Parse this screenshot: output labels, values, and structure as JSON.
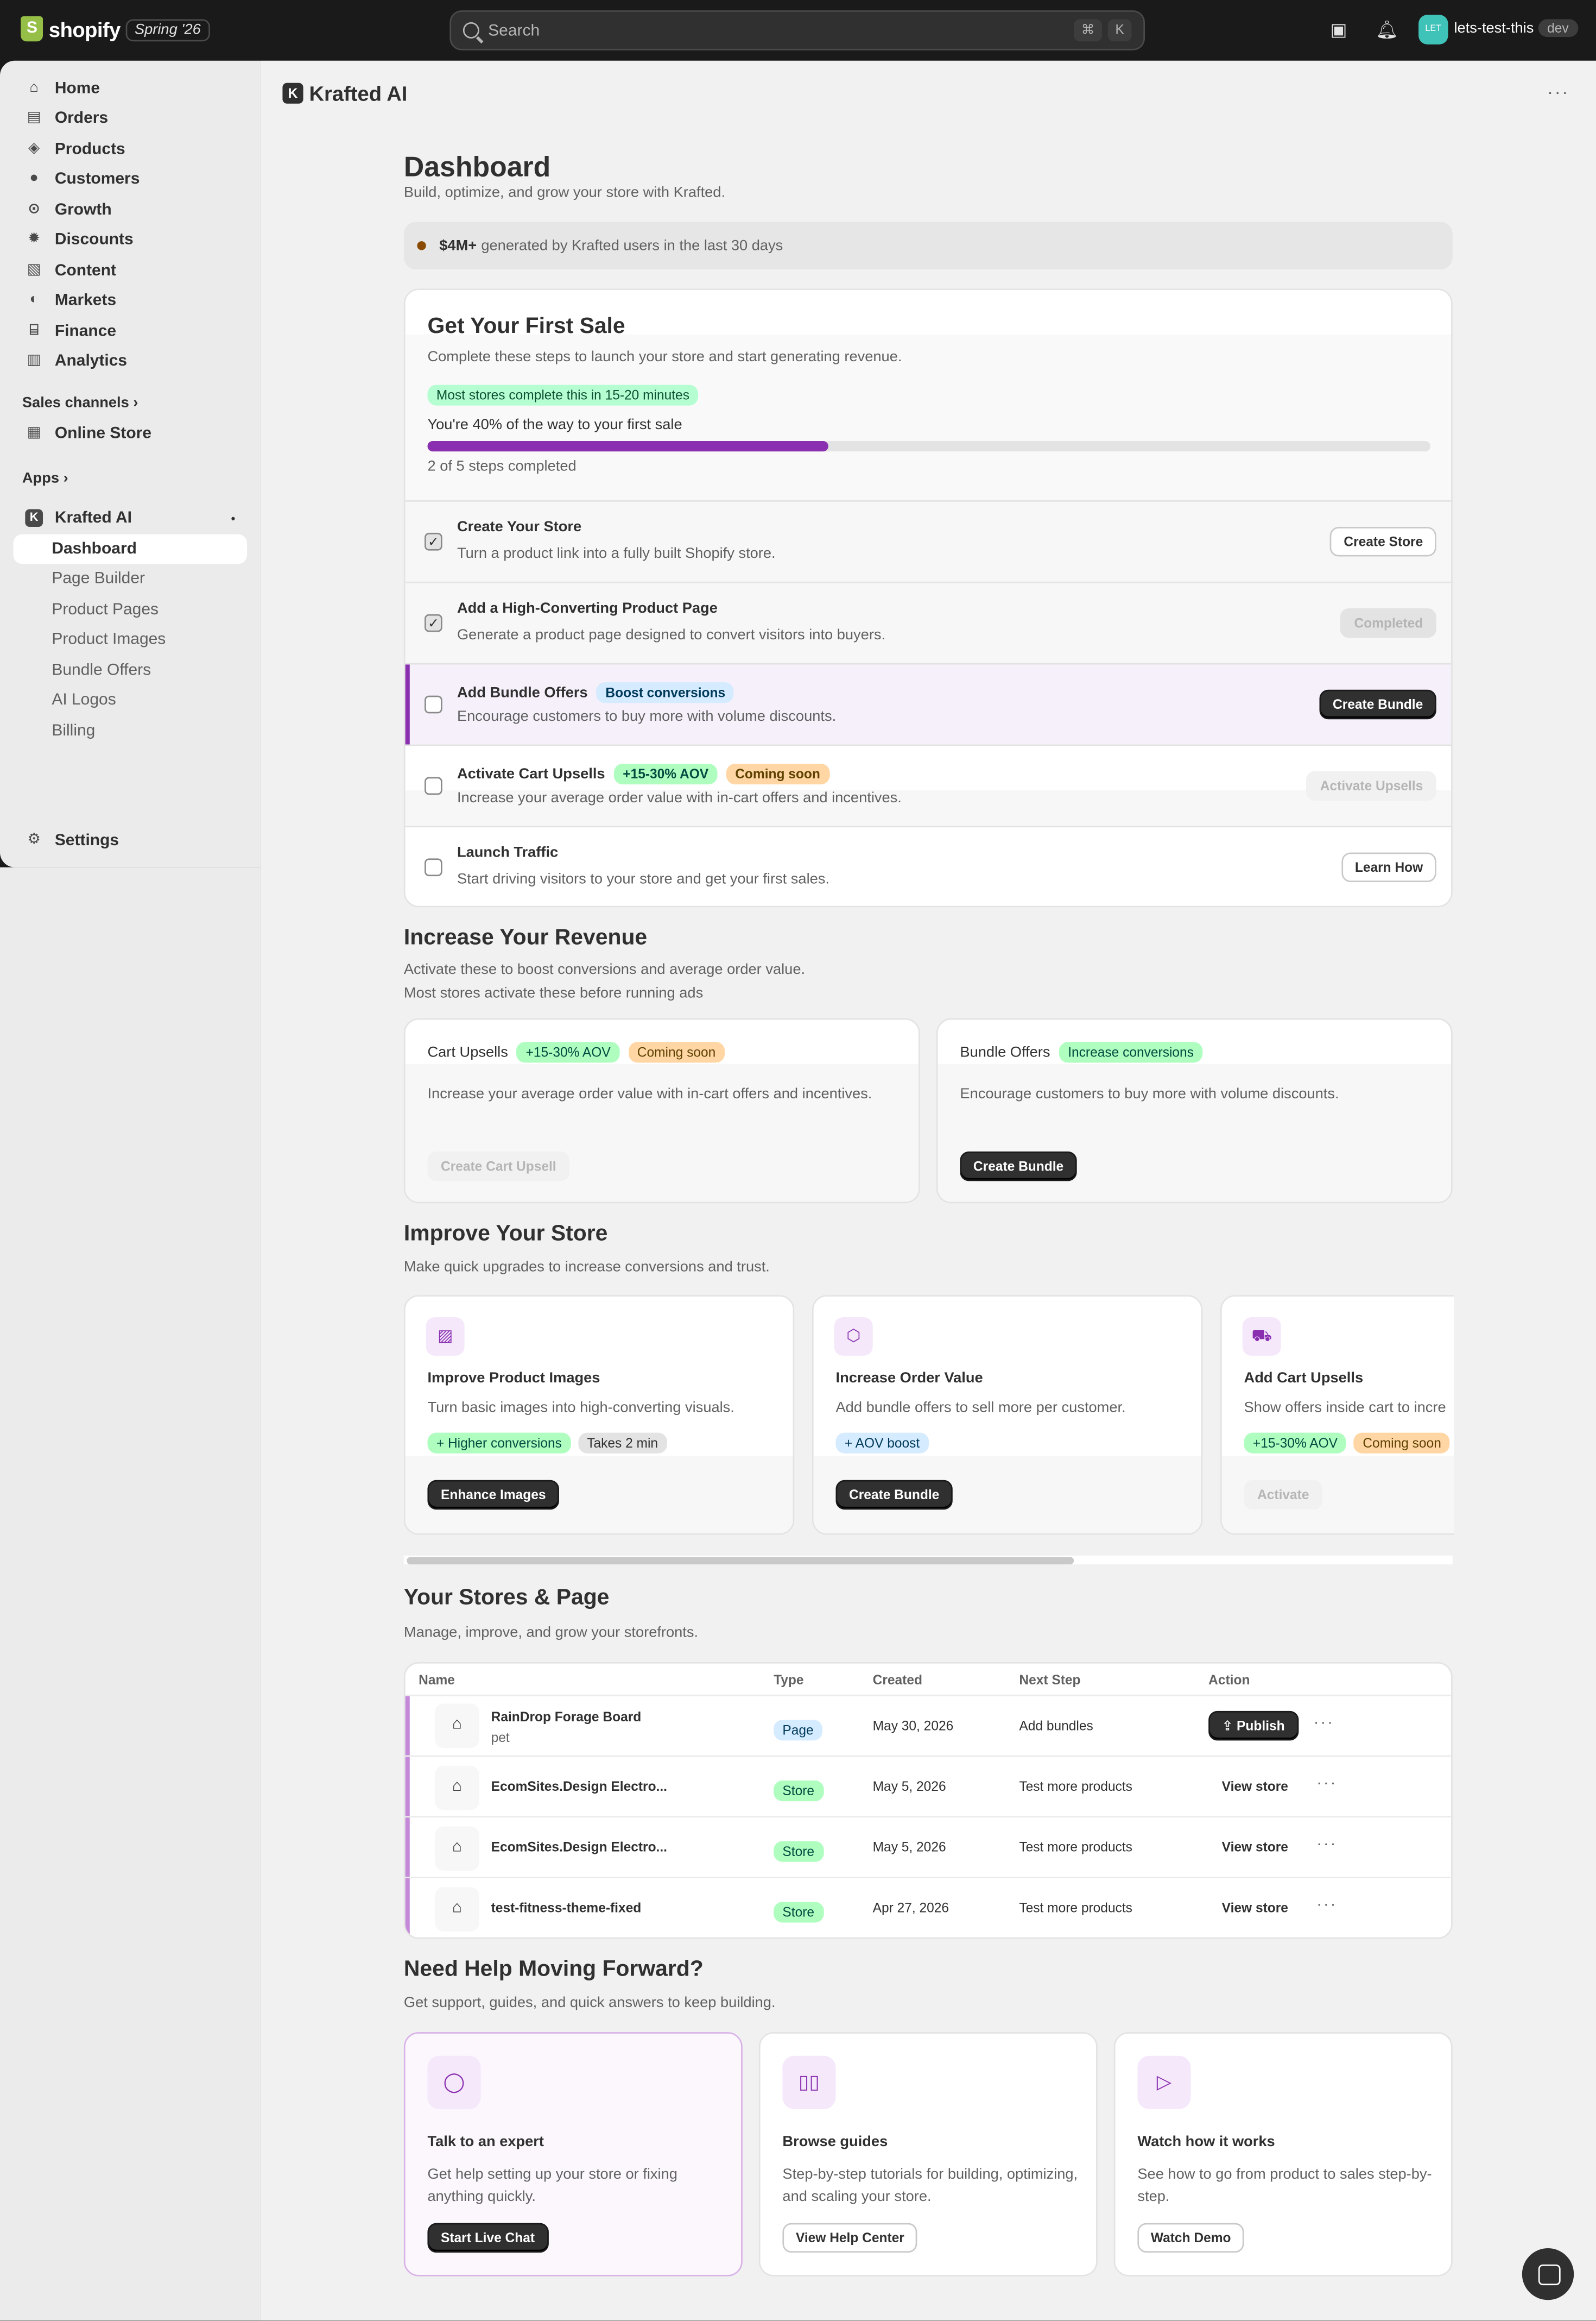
{
  "topbar": {
    "brand": "shopify",
    "season": "Spring '26",
    "search_placeholder": "Search",
    "shortcut_1": "⌘",
    "shortcut_2": "K",
    "avatar_initials": "LET",
    "store_name": "lets-test-this",
    "env_badge": "dev"
  },
  "sidebar": {
    "items": [
      {
        "label": "Home",
        "icon": "home-icon"
      },
      {
        "label": "Orders",
        "icon": "orders-icon"
      },
      {
        "label": "Products",
        "icon": "tag-icon"
      },
      {
        "label": "Customers",
        "icon": "person-icon"
      },
      {
        "label": "Growth",
        "icon": "growth-icon"
      },
      {
        "label": "Discounts",
        "icon": "discount-icon"
      },
      {
        "label": "Content",
        "icon": "content-icon"
      },
      {
        "label": "Markets",
        "icon": "globe-icon"
      },
      {
        "label": "Finance",
        "icon": "bank-icon"
      },
      {
        "label": "Analytics",
        "icon": "chart-icon"
      }
    ],
    "sales_channels_label": "Sales channels",
    "online_store_label": "Online Store",
    "apps_label": "Apps",
    "app_name": "Krafted AI",
    "app_sub_items": [
      "Dashboard",
      "Page Builder",
      "Product Pages",
      "Product Images",
      "Bundle Offers",
      "AI Logos",
      "Billing"
    ],
    "settings_label": "Settings"
  },
  "app_header": {
    "title": "Krafted AI",
    "logo_letter": "K"
  },
  "dashboard": {
    "title": "Dashboard",
    "subtitle": "Build, optimize, and grow your store with Krafted.",
    "banner_bold": "$4M+",
    "banner_text": "generated by Krafted users in the last 30 days"
  },
  "first_sale": {
    "title": "Get Your First Sale",
    "subtitle": "Complete these steps to launch your store and start generating revenue.",
    "time_badge": "Most stores complete this in 15-20 minutes",
    "progress_text": "You're 40% of the way to your first sale",
    "progress_fraction": 0.4,
    "steps_completed": "2 of 5 steps completed",
    "steps": [
      {
        "title": "Create Your Store",
        "desc": "Turn a product link into a fully built Shopify store.",
        "button": "Create Store",
        "checked": true
      },
      {
        "title": "Add a High-Converting Product Page",
        "desc": "Generate a product page designed to convert visitors into buyers.",
        "button": "Completed",
        "checked": true
      },
      {
        "title": "Add Bundle Offers",
        "badge": "Boost conversions",
        "desc": "Encourage customers to buy more with volume discounts.",
        "button": "Create Bundle",
        "checked": false
      },
      {
        "title": "Activate Cart Upsells",
        "badge": "+15-30% AOV",
        "badge2": "Coming soon",
        "desc": "Increase your average order value with in-cart offers and incentives.",
        "button": "Activate Upsells",
        "checked": false
      },
      {
        "title": "Launch Traffic",
        "desc": "Start driving visitors to your store and get your first sales.",
        "button": "Learn How",
        "checked": false
      }
    ]
  },
  "revenue": {
    "title": "Increase Your Revenue",
    "subtitle_1": "Activate these to boost conversions and average order value.",
    "subtitle_2": "Most stores activate these before running ads",
    "cards": [
      {
        "title": "Cart Upsells",
        "badge": "+15-30% AOV",
        "badge2": "Coming soon",
        "desc": "Increase your average order value with in-cart offers and incentives.",
        "button": "Create Cart Upsell"
      },
      {
        "title": "Bundle Offers",
        "badge": "Increase conversions",
        "desc": "Encourage customers to buy more with volume discounts.",
        "button": "Create Bundle"
      }
    ]
  },
  "improve": {
    "title": "Improve Your Store",
    "subtitle": "Make quick upgrades to increase conversions and trust.",
    "cards": [
      {
        "title": "Improve Product Images",
        "desc": "Turn basic images into high-converting visuals.",
        "badge": "+ Higher conversions",
        "badge2": "Takes 2 min",
        "button": "Enhance Images"
      },
      {
        "title": "Increase Order Value",
        "desc": "Add bundle offers to sell more per customer.",
        "badge": "+ AOV boost",
        "button": "Create Bundle"
      },
      {
        "title": "Add Cart Upsells",
        "desc": "Show offers inside cart to incre",
        "badge": "+15-30% AOV",
        "badge2": "Coming soon",
        "button": "Activate"
      }
    ]
  },
  "stores": {
    "title": "Your Stores & Page",
    "subtitle": "Manage, improve, and grow your storefronts.",
    "columns": [
      "Name",
      "Type",
      "Created",
      "Next Step",
      "Action"
    ],
    "rows": [
      {
        "name": "RainDrop Forage Board",
        "sub": "pet",
        "type": "Page",
        "created": "May 30, 2026",
        "next": "Add bundles",
        "action": "Publish"
      },
      {
        "name": "EcomSites.Design Electro...",
        "type": "Store",
        "created": "May 5, 2026",
        "next": "Test more products",
        "action": "View store"
      },
      {
        "name": "EcomSites.Design Electro...",
        "type": "Store",
        "created": "May 5, 2026",
        "next": "Test more products",
        "action": "View store"
      },
      {
        "name": "test-fitness-theme-fixed",
        "type": "Store",
        "created": "Apr 27, 2026",
        "next": "Test more products",
        "action": "View store"
      }
    ]
  },
  "help": {
    "title": "Need Help Moving Forward?",
    "subtitle": "Get support, guides, and quick answers to keep building.",
    "cards": [
      {
        "title": "Talk to an expert",
        "desc": "Get help setting up your store or fixing anything quickly.",
        "button": "Start Live Chat"
      },
      {
        "title": "Browse guides",
        "desc": "Step-by-step tutorials for building, optimizing, and scaling your store.",
        "button": "View Help Center"
      },
      {
        "title": "Watch how it works",
        "desc": "See how to go from product to sales step-by-step.",
        "button": "Watch Demo"
      }
    ]
  }
}
